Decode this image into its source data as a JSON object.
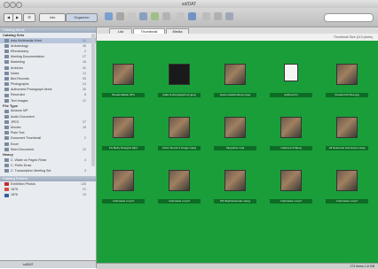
{
  "window": {
    "title": "sd/DAT"
  },
  "toolbar": {
    "btn_info": "Info",
    "btn_organizer": "Organizer"
  },
  "tabs": [
    {
      "label": "List"
    },
    {
      "label": "Thumbnail"
    },
    {
      "label": "Media"
    }
  ],
  "subbar": {
    "status": "Thumbnail Size  (113 pixels)"
  },
  "sidebar": {
    "header": "Catalog Items",
    "sections": [
      {
        "title": "Catalog Sets",
        "items": [
          {
            "label": "Asia Multimedia Wrmt",
            "count": "11"
          },
          {
            "label": "Archaeology",
            "count": "36"
          },
          {
            "label": "Ethnobotany",
            "count": "2"
          },
          {
            "label": "Meeting Documentation",
            "count": "27"
          },
          {
            "label": "Marketing",
            "count": "18"
          },
          {
            "label": "Archives",
            "count": "42"
          },
          {
            "label": "Notes",
            "count": "13"
          },
          {
            "label": "Bird Records",
            "count": "93"
          },
          {
            "label": "Photographs",
            "count": "24"
          },
          {
            "label": "Authorized Photograph Items",
            "count": "30"
          },
          {
            "label": "Recorded",
            "count": "8"
          },
          {
            "label": "Text Images",
            "count": "12"
          }
        ]
      },
      {
        "title": "File Type",
        "items": [
          {
            "label": "Amazon MP",
            "count": ""
          },
          {
            "label": "Audio Document",
            "count": ""
          },
          {
            "label": "JPEG",
            "count": "37"
          },
          {
            "label": "Movies",
            "count": "18"
          },
          {
            "label": "Plain Text",
            "count": ""
          },
          {
            "label": "Document Thumbnail",
            "count": "2"
          },
          {
            "label": "Excel",
            "count": ""
          },
          {
            "label": "Word Document",
            "count": "12"
          }
        ]
      },
      {
        "title": "Heavy",
        "items": [
          {
            "label": "C. Water on Pages Rinse",
            "count": "4"
          },
          {
            "label": "C. Prefix Draw",
            "count": ""
          },
          {
            "label": "C. Transcription Meeting Set",
            "count": "3"
          }
        ]
      }
    ],
    "catalog_header": "Catalog Folders",
    "catalog_items": [
      {
        "label": "Exhibition Photos",
        "count": "126"
      },
      {
        "label": "1875",
        "count": "21"
      },
      {
        "label": "1876",
        "count": "19"
      }
    ],
    "footer": "sd/DAT"
  },
  "thumbnails": [
    {
      "caption": "WoodenMask.JPG",
      "kind": "photo"
    },
    {
      "caption": "plate-9-photograph-pc.jpeg",
      "kind": "dark"
    },
    {
      "caption": "steel-metalworking.mpeg",
      "kind": "photo"
    },
    {
      "caption": "anthropi.txt",
      "kind": "white"
    },
    {
      "caption": "Flooded Archive.jpg",
      "kind": "photo"
    },
    {
      "caption": "Fly Baby Designer.Mp4",
      "kind": "photo"
    },
    {
      "caption": "Arbor Sound 4 Image.mpeg",
      "kind": "photo"
    },
    {
      "caption": "Skypeline.mp4",
      "kind": "photo"
    },
    {
      "caption": "collected 3.Mpeg",
      "kind": "photo"
    },
    {
      "caption": "All Seasonal Interviews.mpeg",
      "kind": "photo"
    },
    {
      "caption": "Interviews 1.mp4",
      "kind": "photo"
    },
    {
      "caption": "Interviews 1.mp4",
      "kind": "photo"
    },
    {
      "caption": "NS Skylinewoman.mpeg",
      "kind": "photo"
    },
    {
      "caption": "Interviews 1.mp4",
      "kind": "photo"
    },
    {
      "caption": "Interviews 1.mp4",
      "kind": "photo"
    }
  ],
  "status": {
    "right": "173 items  1.6 GB"
  },
  "colors": {
    "grid_bg": "#1a9e3a",
    "sidebar_bg": "#e8ebef"
  }
}
